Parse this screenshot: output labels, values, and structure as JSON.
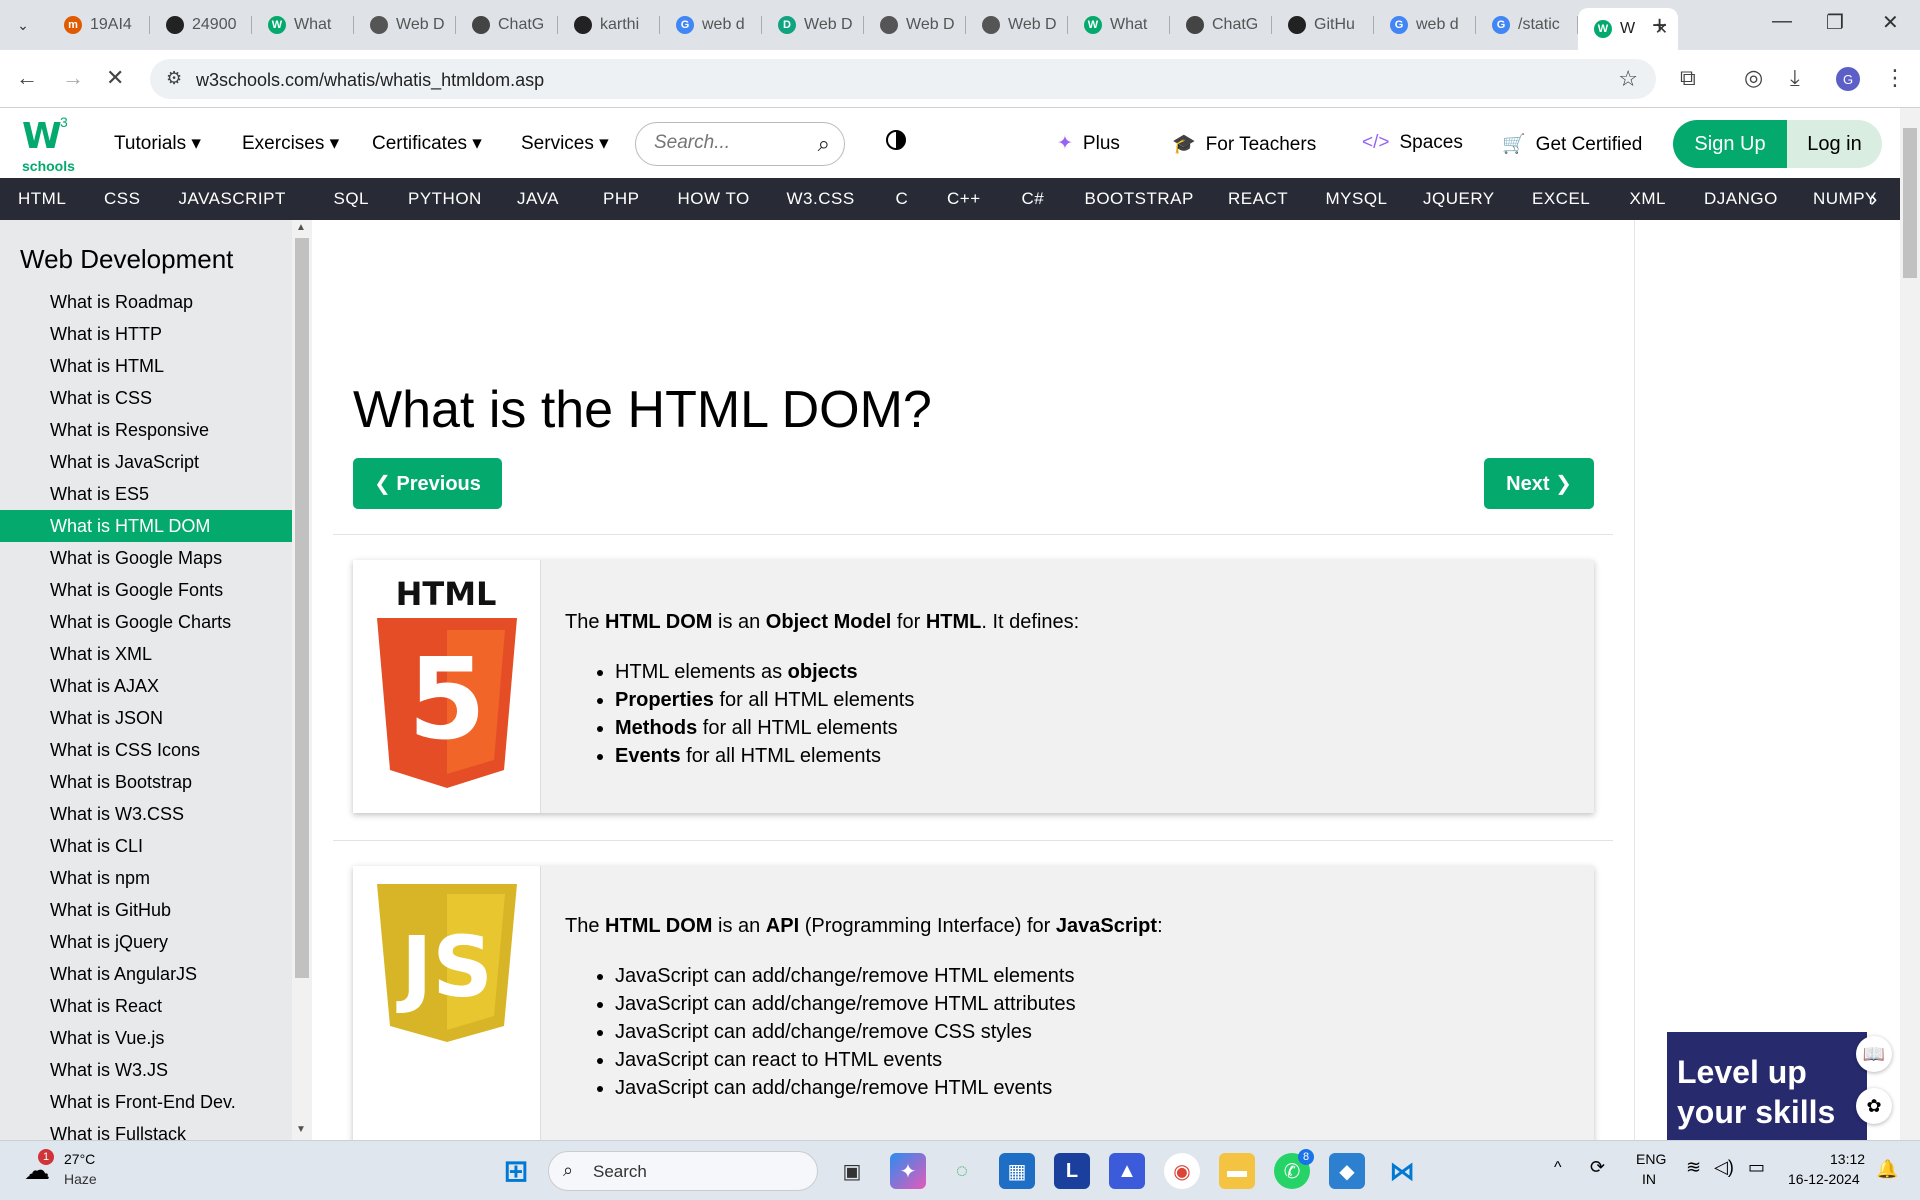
{
  "browser": {
    "tabs": [
      {
        "label": "19AI4",
        "fav": "m",
        "color": "#e05a00"
      },
      {
        "label": "24900",
        "fav": "gh",
        "color": "#222222"
      },
      {
        "label": "What",
        "fav": "W",
        "color": "#04aa6d"
      },
      {
        "label": "Web D",
        "fav": "gl",
        "color": "#555555"
      },
      {
        "label": "ChatG",
        "fav": "ai",
        "color": "#444444"
      },
      {
        "label": "karthi",
        "fav": "gh",
        "color": "#222222"
      },
      {
        "label": "web d",
        "fav": "G",
        "color": "#4285f4"
      },
      {
        "label": "Web D",
        "fav": "D",
        "color": "#10a37f"
      },
      {
        "label": "Web D",
        "fav": "gl",
        "color": "#555555"
      },
      {
        "label": "Web D",
        "fav": "gl",
        "color": "#555555"
      },
      {
        "label": "What",
        "fav": "W",
        "color": "#04aa6d"
      },
      {
        "label": "ChatG",
        "fav": "ai",
        "color": "#444444"
      },
      {
        "label": "GitHu",
        "fav": "gh",
        "color": "#222222"
      },
      {
        "label": "web d",
        "fav": "G",
        "color": "#4285f4"
      },
      {
        "label": "/static",
        "fav": "G",
        "color": "#4285f4"
      }
    ],
    "active_tab": {
      "label": "W",
      "fav": "W",
      "color": "#04aa6d"
    },
    "url": "w3schools.com/whatis/whatis_htmldom.asp",
    "profile_initial": "G"
  },
  "header": {
    "logo_sub": "schools",
    "menus": [
      "Tutorials",
      "Exercises",
      "Certificates",
      "Services"
    ],
    "search_placeholder": "Search...",
    "links": [
      {
        "icon": "sparkle-icon",
        "glyph": "✦",
        "label": "Plus"
      },
      {
        "icon": "graduation-cap-icon",
        "glyph": "🎓",
        "label": "For Teachers"
      },
      {
        "icon": "code-icon",
        "glyph": "</>",
        "label": "Spaces"
      },
      {
        "icon": "cart-icon",
        "glyph": "🛒",
        "label": "Get Certified"
      }
    ],
    "signup": "Sign Up",
    "login": "Log in"
  },
  "topnav": [
    "HTML",
    "CSS",
    "JAVASCRIPT",
    "SQL",
    "PYTHON",
    "JAVA",
    "PHP",
    "HOW TO",
    "W3.CSS",
    "C",
    "C++",
    "C#",
    "BOOTSTRAP",
    "REACT",
    "MYSQL",
    "JQUERY",
    "EXCEL",
    "XML",
    "DJANGO",
    "NUMPY"
  ],
  "sidebar": {
    "title": "Web Development",
    "active_index": 7,
    "items": [
      "What is Roadmap",
      "What is HTTP",
      "What is HTML",
      "What is CSS",
      "What is Responsive",
      "What is JavaScript",
      "What is ES5",
      "What is HTML DOM",
      "What is Google Maps",
      "What is Google Fonts",
      "What is Google Charts",
      "What is XML",
      "What is AJAX",
      "What is JSON",
      "What is CSS Icons",
      "What is Bootstrap",
      "What is W3.CSS",
      "What is CLI",
      "What is npm",
      "What is GitHub",
      "What is jQuery",
      "What is AngularJS",
      "What is React",
      "What is Vue.js",
      "What is W3.JS",
      "What is Front-End Dev.",
      "What is Fullstack"
    ]
  },
  "main": {
    "title": "What is the HTML DOM?",
    "prev": "❮ Previous",
    "next": "Next ❯",
    "card1": {
      "logo_text": "HTML",
      "logo_digit": "5",
      "intro": [
        "The ",
        "HTML DOM",
        " is an ",
        "Object Model",
        " for ",
        "HTML",
        ". It defines:"
      ],
      "bullets": [
        [
          "HTML elements as ",
          "objects",
          ""
        ],
        [
          "",
          "Properties",
          " for all HTML elements"
        ],
        [
          "",
          "Methods",
          " for all HTML elements"
        ],
        [
          "",
          "Events",
          " for all HTML elements"
        ]
      ]
    },
    "card2": {
      "logo_text": "JS",
      "intro": [
        "The ",
        "HTML DOM",
        " is an ",
        "API",
        " (Programming Interface) for ",
        "JavaScript",
        ":"
      ],
      "bullets": [
        "JavaScript can add/change/remove HTML elements",
        "JavaScript can add/change/remove HTML attributes",
        "JavaScript can add/change/remove CSS styles",
        "JavaScript can react to HTML events",
        "JavaScript can add/change/remove HTML events"
      ]
    }
  },
  "promo": {
    "line1": "Level up",
    "line2": "your skills"
  },
  "taskbar": {
    "temp": "27°C",
    "weather": "Haze",
    "weather_badge": "1",
    "search_label": "Search",
    "whatsapp_badge": "8",
    "lang1": "ENG",
    "lang2": "IN",
    "time": "13:12",
    "date": "16-12-2024"
  }
}
